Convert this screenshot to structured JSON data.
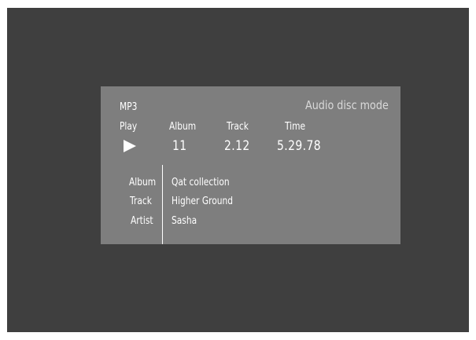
{
  "panel": {
    "format": "MP3",
    "mode": "Audio disc mode",
    "headers": {
      "play": "Play",
      "album": "Album",
      "track": "Track",
      "time": "Time"
    },
    "values": {
      "album": "11",
      "track": "2.12",
      "time": "5.29.78"
    },
    "status_icon": "play-icon",
    "info": {
      "album_label": "Album",
      "album_value": "Qat collection",
      "track_label": "Track",
      "track_value": "Higher Ground",
      "artist_label": "Artist",
      "artist_value": "Sasha"
    }
  },
  "colors": {
    "background": "#3f3f3f",
    "panel": "#7e7e7e",
    "text": "#ffffff"
  }
}
